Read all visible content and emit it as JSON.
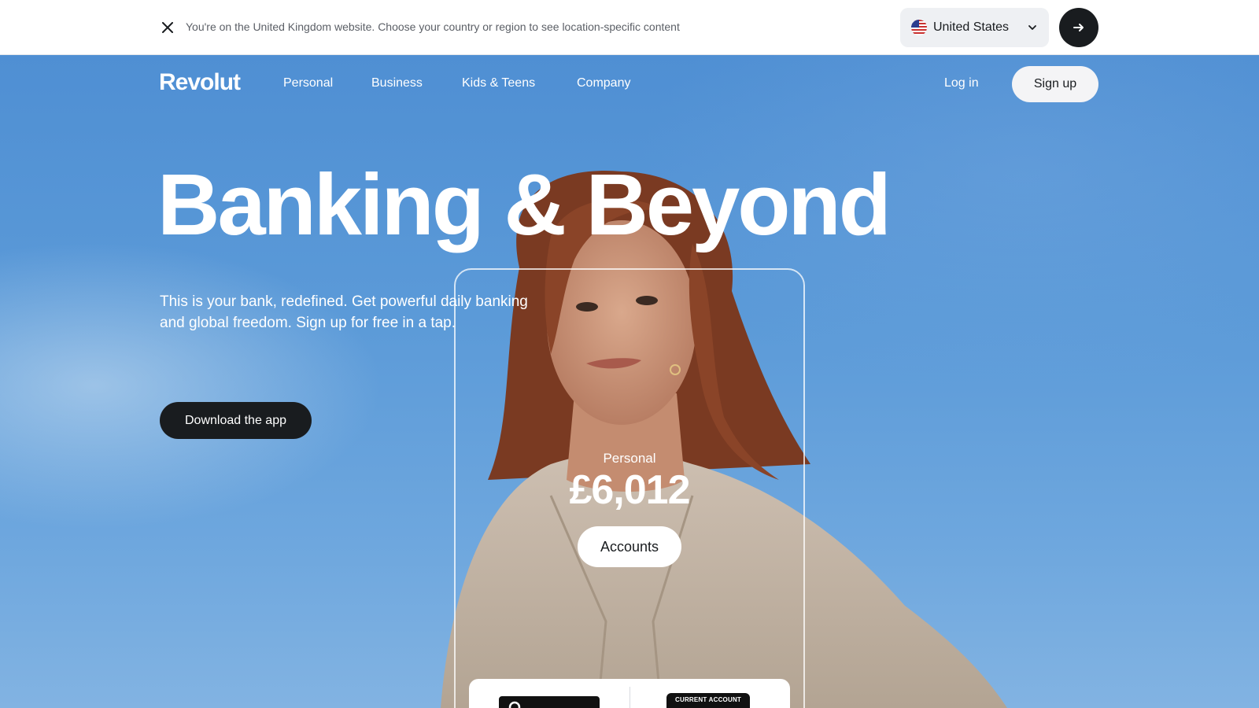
{
  "banner": {
    "message": "You're on the United Kingdom website. Choose your country or region to see location-specific content",
    "country": "United States",
    "close_icon": "close-icon",
    "go_icon": "arrow-right-icon"
  },
  "nav": {
    "logo": "Revolut",
    "items": [
      {
        "label": "Personal"
      },
      {
        "label": "Business"
      },
      {
        "label": "Kids & Teens"
      },
      {
        "label": "Company"
      }
    ],
    "login": "Log in",
    "signup": "Sign up"
  },
  "hero": {
    "headline": "Banking & Beyond",
    "subtext": "This is your bank, redefined. Get powerful daily banking and global freedom. Sign up for free in a tap.",
    "cta": "Download the app"
  },
  "account_card": {
    "label": "Personal",
    "balance": "£6,012",
    "button": "Accounts",
    "card_badge": "CURRENT ACCOUNT"
  },
  "colors": {
    "sky": "#5b9ad8",
    "dark": "#191c1f",
    "white": "#ffffff"
  }
}
